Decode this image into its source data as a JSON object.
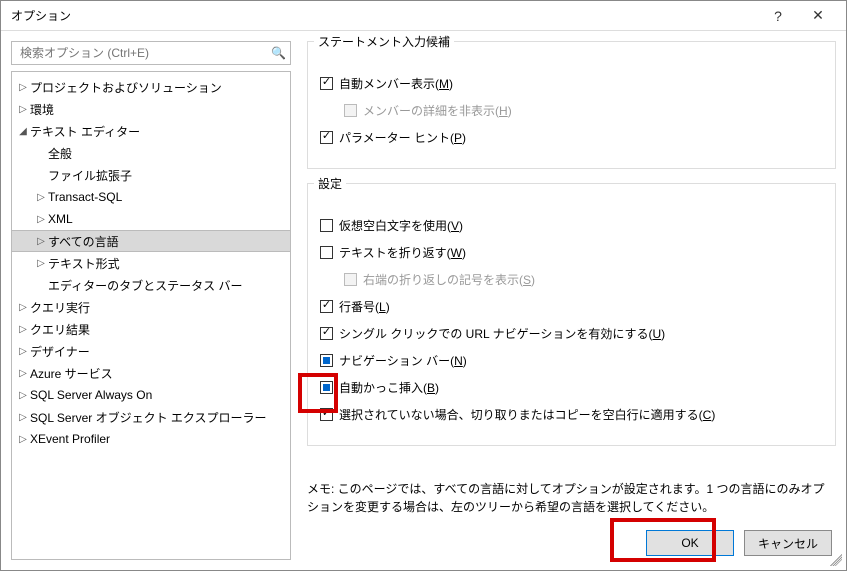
{
  "window": {
    "title": "オプション"
  },
  "search": {
    "placeholder": "検索オプション (Ctrl+E)"
  },
  "tree": [
    {
      "label": "プロジェクトおよびソリューション",
      "depth": 0,
      "arrow": "▷",
      "selected": false
    },
    {
      "label": "環境",
      "depth": 0,
      "arrow": "▷",
      "selected": false
    },
    {
      "label": "テキスト エディター",
      "depth": 0,
      "arrow": "◢",
      "selected": false
    },
    {
      "label": "全般",
      "depth": 1,
      "arrow": "",
      "selected": false
    },
    {
      "label": "ファイル拡張子",
      "depth": 1,
      "arrow": "",
      "selected": false
    },
    {
      "label": "Transact-SQL",
      "depth": 1,
      "arrow": "▷",
      "selected": false
    },
    {
      "label": "XML",
      "depth": 1,
      "arrow": "▷",
      "selected": false
    },
    {
      "label": "すべての言語",
      "depth": 1,
      "arrow": "▷",
      "selected": true
    },
    {
      "label": "テキスト形式",
      "depth": 1,
      "arrow": "▷",
      "selected": false
    },
    {
      "label": "エディターのタブとステータス バー",
      "depth": 1,
      "arrow": "",
      "selected": false
    },
    {
      "label": "クエリ実行",
      "depth": 0,
      "arrow": "▷",
      "selected": false
    },
    {
      "label": "クエリ結果",
      "depth": 0,
      "arrow": "▷",
      "selected": false
    },
    {
      "label": "デザイナー",
      "depth": 0,
      "arrow": "▷",
      "selected": false
    },
    {
      "label": "Azure サービス",
      "depth": 0,
      "arrow": "▷",
      "selected": false
    },
    {
      "label": "SQL Server Always On",
      "depth": 0,
      "arrow": "▷",
      "selected": false
    },
    {
      "label": "SQL Server オブジェクト エクスプローラー",
      "depth": 0,
      "arrow": "▷",
      "selected": false
    },
    {
      "label": "XEvent Profiler",
      "depth": 0,
      "arrow": "▷",
      "selected": false
    }
  ],
  "groups": {
    "statement": {
      "title": "ステートメント入力候補",
      "auto_member": {
        "text": "自動メンバー表示",
        "accel": "M",
        "checked": true,
        "disabled": false
      },
      "member_detail": {
        "text": "メンバーの詳細を非表示",
        "accel": "H",
        "checked": false,
        "disabled": true
      },
      "param_hint": {
        "text": "パラメーター ヒント",
        "accel": "P",
        "checked": true,
        "disabled": false
      }
    },
    "settings": {
      "title": "設定",
      "virtual_ws": {
        "text": "仮想空白文字を使用",
        "accel": "V",
        "checked": false,
        "disabled": false
      },
      "wrap": {
        "text": "テキストを折り返す",
        "accel": "W",
        "checked": false,
        "disabled": false
      },
      "wrap_glyph": {
        "text": "右端の折り返しの記号を表示",
        "accel": "S",
        "checked": false,
        "disabled": true
      },
      "line_no": {
        "text": "行番号",
        "accel": "L",
        "checked": true,
        "disabled": false
      },
      "url_nav": {
        "text": "シングル クリックでの URL ナビゲーションを有効にする",
        "accel": "U",
        "checked": true,
        "disabled": false
      },
      "nav_bar": {
        "text": "ナビゲーション バー",
        "accel": "N",
        "state": "indet",
        "disabled": false
      },
      "auto_brace": {
        "text": "自動かっこ挿入",
        "accel": "B",
        "state": "indet",
        "disabled": false
      },
      "cut_copy": {
        "text": "選択されていない場合、切り取りまたはコピーを空白行に適用する",
        "accel": "C",
        "checked": true,
        "disabled": false
      }
    }
  },
  "note": "メモ: このページでは、すべての言語に対してオプションが設定されます。1 つの言語にのみオプションを変更する場合は、左のツリーから希望の言語を選択してください。",
  "buttons": {
    "ok": "OK",
    "cancel": "キャンセル"
  }
}
